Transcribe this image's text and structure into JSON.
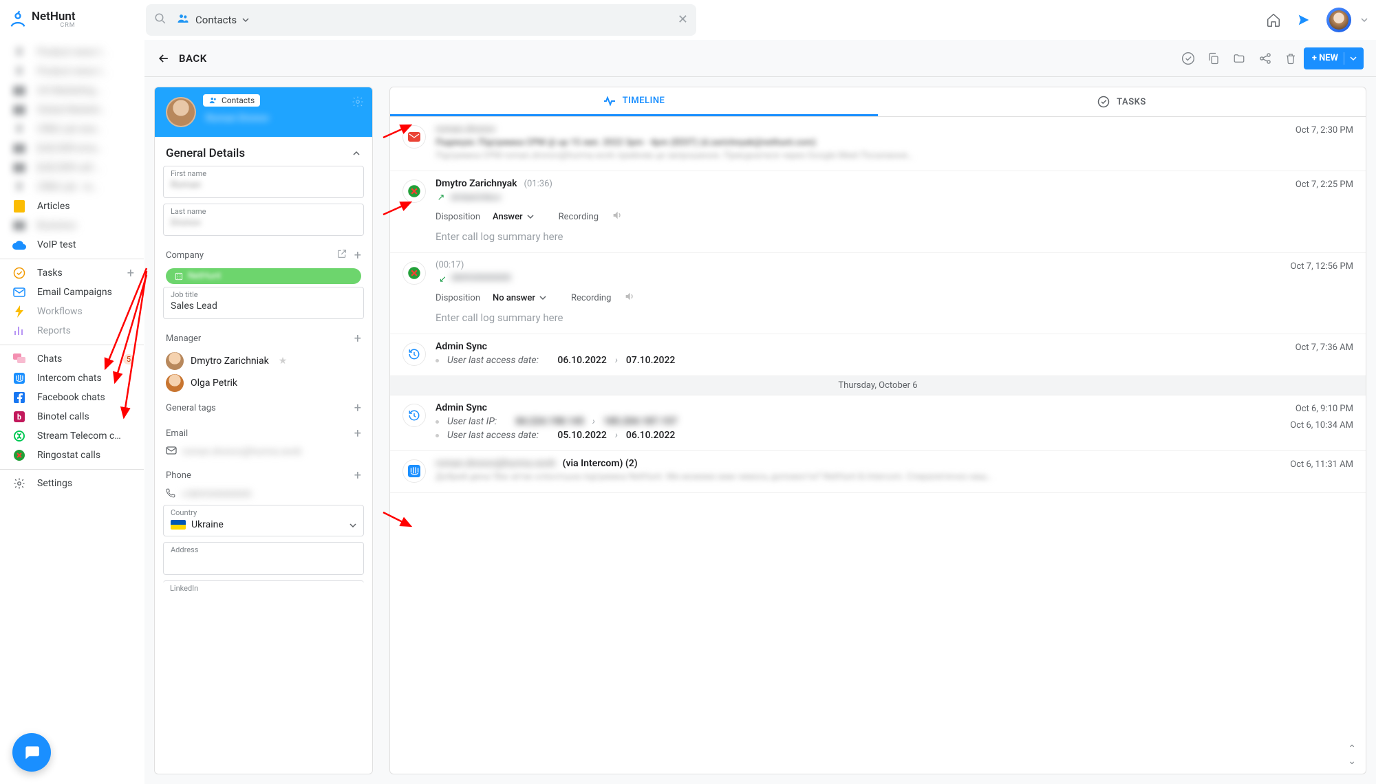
{
  "topbar": {
    "logo_text": "NetHunt",
    "logo_sub": "CRM",
    "search_scope": "Contacts"
  },
  "subbar": {
    "back": "BACK",
    "new_btn": "+ NEW"
  },
  "sidebar": {
    "folders_blurred": [
      "Product news l…",
      "Product news l…",
      "UA Marketing …",
      "Global Marketi…",
      "CRM Lab new…",
      "[UA] SDR ema…",
      "[UA] SDR call …",
      "CRM Lab · re…"
    ],
    "articles": "Articles",
    "blur_one_more": "Business",
    "voip": "VoIP test",
    "tasks": "Tasks",
    "email_campaigns": "Email Campaigns",
    "workflows": "Workflows",
    "reports": "Reports",
    "chats": "Chats",
    "badge": "5",
    "intercom": "Intercom chats",
    "facebook": "Facebook chats",
    "binotel": "Binotel calls",
    "stream": "Stream Telecom c…",
    "ringostat": "Ringostat calls",
    "settings": "Settings"
  },
  "details": {
    "contacts_chip": "Contacts",
    "section_general": "General Details",
    "first_name_label": "First name",
    "first_name_value": "Roman",
    "last_name_label": "Last name",
    "last_name_value": "Dronov",
    "company_label": "Company",
    "company_value": "NetHunt",
    "job_title_label": "Job title",
    "job_title_value": "Sales Lead",
    "manager_label": "Manager",
    "manager_1": "Dmytro Zarichniak",
    "manager_2": "Olga Petrik",
    "tags_label": "General tags",
    "email_label": "Email",
    "email_value": "roman.dronov@hurma.work",
    "phone_label": "Phone",
    "phone_value": "+380930000000",
    "country_label": "Country",
    "country_value": "Ukraine",
    "address_label": "Address",
    "linkedin_label": "LinkedIn"
  },
  "tabs": {
    "timeline": "TIMELINE",
    "tasks": "TASKS"
  },
  "timeline": {
    "items": [
      {
        "kind": "email",
        "title": "roman.dronov",
        "line1": "Подякую: Підтримка СРМ @ up 15 лип. 2022 3pm · 4pm (EEST) (d.zarichnyak@nethunt.com)",
        "line2": "Підтримка СРМ roman.dronov@hurma.work прийняв це запрошення. Приєднатися через Google Meet Посилання…",
        "time": "Oct 7, 2:30 PM"
      },
      {
        "kind": "call-out",
        "title": "Dmytro Zarichnyak",
        "duration": "(01:36)",
        "sub": "dmbelchikov",
        "disposition": "Answer",
        "recording": "Recording",
        "summary_ph": "Enter call log summary here",
        "time": "Oct 7, 2:25 PM"
      },
      {
        "kind": "call-in",
        "title": "",
        "duration": "(00:17)",
        "sub": "380930000000",
        "disposition": "No answer",
        "recording": "Recording",
        "summary_ph": "Enter call log summary here",
        "time": "Oct 7, 12:56 PM"
      },
      {
        "kind": "sync",
        "title": "Admin Sync",
        "label": "User last access date:",
        "from": "06.10.2022",
        "to": "07.10.2022",
        "time": "Oct 7, 7:36 AM"
      }
    ],
    "divider": "Thursday, October 6",
    "sync2_title": "Admin Sync",
    "sync2_ip_label": "User last IP:",
    "sync2_ip_from": "84.224.198.145",
    "sync2_ip_to": "185.204.187.157",
    "sync2_date_label": "User last access date:",
    "sync2_date_from": "05.10.2022",
    "sync2_date_to": "06.10.2022",
    "sync2_time1": "Oct 6, 9:10 PM",
    "sync2_time2": "Oct 6, 10:34 AM",
    "intercom_title_blur": "roman.dronov@hurma.work",
    "intercom_suffix": " (via Intercom) (2)",
    "intercom_time": "Oct 6, 11:31 AM",
    "intercom_body": "Добрий день! Вас вітає клієнтська підтримка NetHunt. Ми можемо вам чимось допомогти? NetHunt & Intercom.   Спиралетично наш…",
    "disposition_label": "Disposition",
    "recording_label": "Recording"
  }
}
